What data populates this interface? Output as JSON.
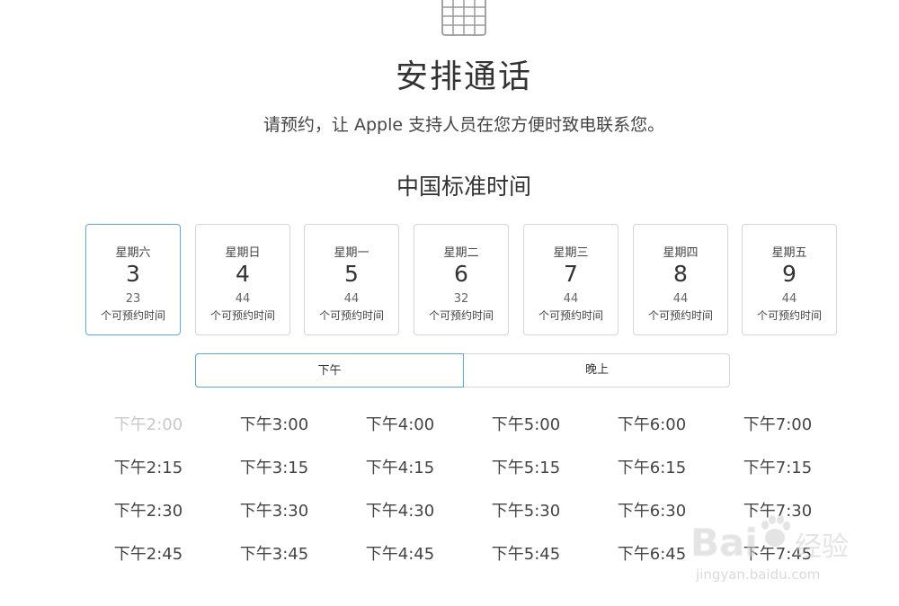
{
  "header": {
    "title": "安排通话",
    "subtitle": "请预约，让 Apple 支持人员在您方便时致电联系您。",
    "timezone": "中国标准时间"
  },
  "days": [
    {
      "weekday": "星期六",
      "date": "3",
      "count": "23",
      "label": "个可预约时间",
      "selected": true
    },
    {
      "weekday": "星期日",
      "date": "4",
      "count": "44",
      "label": "个可预约时间",
      "selected": false
    },
    {
      "weekday": "星期一",
      "date": "5",
      "count": "44",
      "label": "个可预约时间",
      "selected": false
    },
    {
      "weekday": "星期二",
      "date": "6",
      "count": "32",
      "label": "个可预约时间",
      "selected": false
    },
    {
      "weekday": "星期三",
      "date": "7",
      "count": "44",
      "label": "个可预约时间",
      "selected": false
    },
    {
      "weekday": "星期四",
      "date": "8",
      "count": "44",
      "label": "个可预约时间",
      "selected": false
    },
    {
      "weekday": "星期五",
      "date": "9",
      "count": "44",
      "label": "个可预约时间",
      "selected": false
    }
  ],
  "period_tabs": {
    "afternoon": "下午",
    "evening": "晚上",
    "selected": "afternoon"
  },
  "time_slots": [
    [
      "下午2:00",
      "下午3:00",
      "下午4:00",
      "下午5:00",
      "下午6:00",
      "下午7:00"
    ],
    [
      "下午2:15",
      "下午3:15",
      "下午4:15",
      "下午5:15",
      "下午6:15",
      "下午7:15"
    ],
    [
      "下午2:30",
      "下午3:30",
      "下午4:30",
      "下午5:30",
      "下午6:30",
      "下午7:30"
    ],
    [
      "下午2:45",
      "下午3:45",
      "下午4:45",
      "下午5:45",
      "下午6:45",
      "下午7:45"
    ]
  ],
  "disabled_slots": [
    "下午2:00"
  ],
  "watermark": {
    "brand": "Bai",
    "brand2": "du",
    "cn": "经验",
    "url": "jingyan.baidu.com"
  },
  "colors": {
    "accent_border": "#5aa9e6",
    "border": "#d6d6d6",
    "disabled_text": "#c8c8c8"
  }
}
